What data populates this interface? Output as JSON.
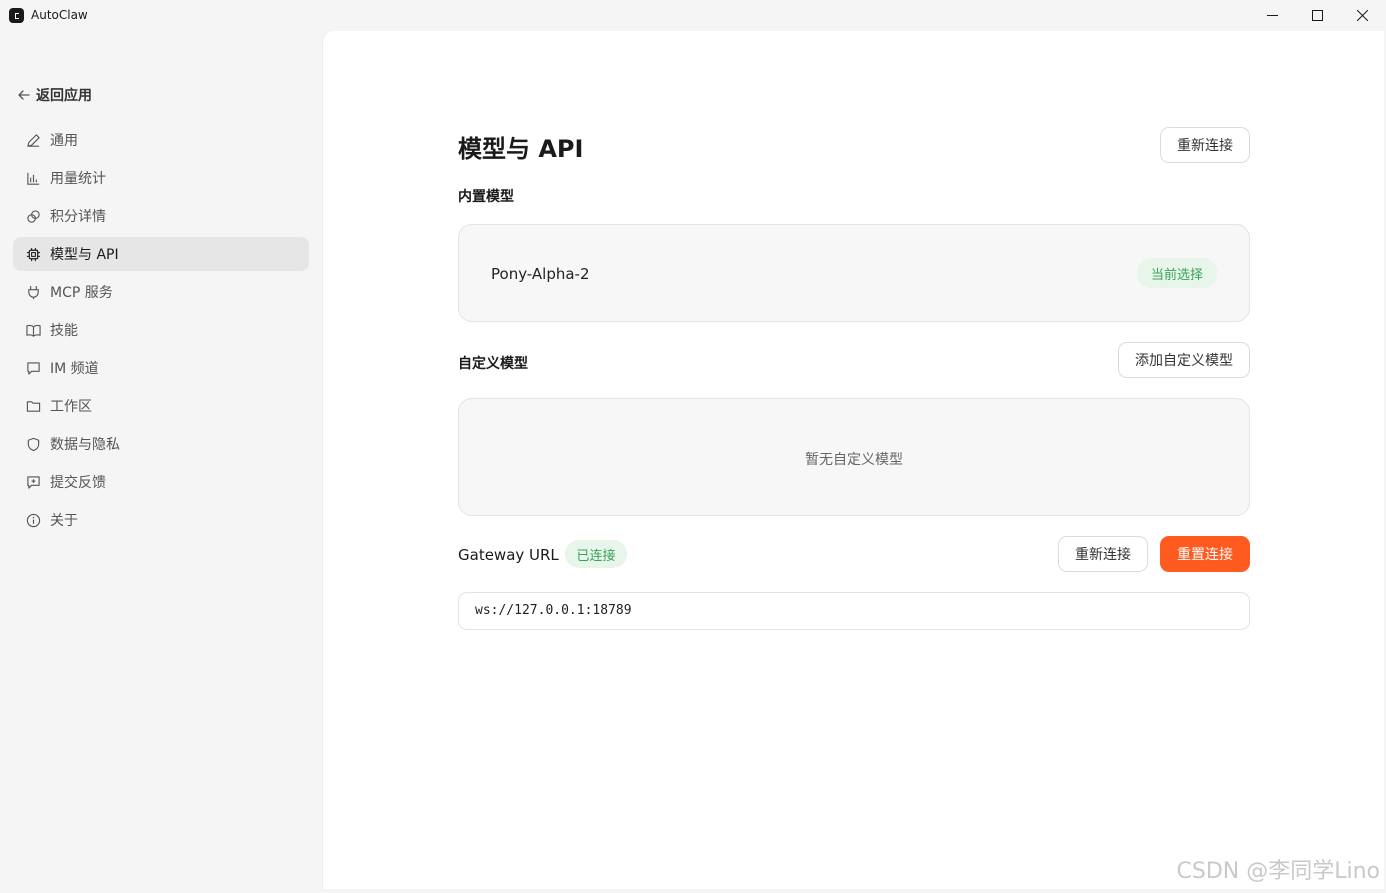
{
  "window": {
    "title": "AutoClaw",
    "controls": {
      "minimize": "—",
      "maximize": "☐",
      "close": "✕"
    }
  },
  "sidebar": {
    "back_label": "返回应用",
    "items": [
      {
        "label": "通用",
        "icon": "pencil-icon"
      },
      {
        "label": "用量统计",
        "icon": "bar-chart-icon"
      },
      {
        "label": "积分详情",
        "icon": "coins-icon"
      },
      {
        "label": "模型与 API",
        "icon": "chip-icon",
        "active": true
      },
      {
        "label": "MCP 服务",
        "icon": "plug-icon"
      },
      {
        "label": "技能",
        "icon": "book-icon"
      },
      {
        "label": "IM 频道",
        "icon": "message-icon"
      },
      {
        "label": "工作区",
        "icon": "folder-icon"
      },
      {
        "label": "数据与隐私",
        "icon": "shield-icon"
      },
      {
        "label": "提交反馈",
        "icon": "feedback-icon"
      },
      {
        "label": "关于",
        "icon": "info-icon"
      }
    ]
  },
  "main": {
    "title": "模型与 API",
    "reconnect_top_label": "重新连接",
    "builtin": {
      "label": "内置模型",
      "model_name": "Pony-Alpha-2",
      "status": "当前选择"
    },
    "custom": {
      "label": "自定义模型",
      "add_label": "添加自定义模型",
      "empty_text": "暂无自定义模型"
    },
    "gateway": {
      "label": "Gateway URL",
      "status": "已连接",
      "reconnect_label": "重新连接",
      "reset_label": "重置连接",
      "url": "ws://127.0.0.1:18789"
    }
  },
  "watermark": "CSDN @李同学Lino",
  "colors": {
    "accent": "#ff5a1f",
    "success": "#3aa35a",
    "success_bg": "#e7f5ea"
  }
}
